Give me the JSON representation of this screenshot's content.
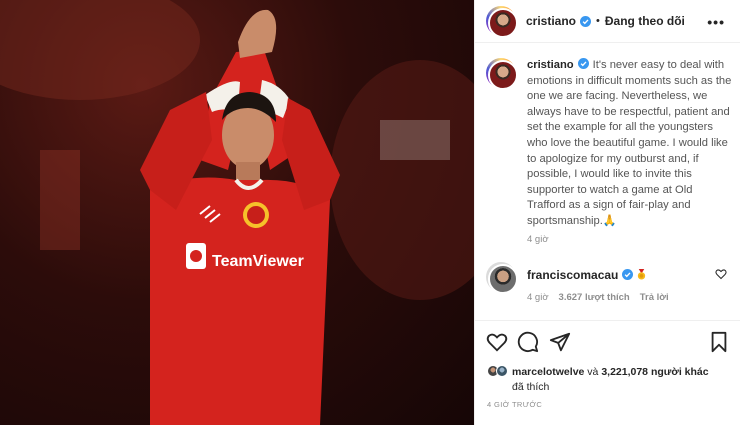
{
  "post": {
    "author": "cristiano",
    "follow_status": "Đang theo dõi",
    "more_glyph": "•••",
    "separator": "•"
  },
  "caption": {
    "username": "cristiano",
    "text": "It's never easy to deal with emotions in difficult moments such as the one we are facing. Nevertheless, we always have to be respectful, patient and set the example for all the youngsters who love the beautiful game. I would like to apologize for my outburst and, if possible, I would like to invite this supporter to watch a game at Old Trafford as a sign of fair-play and sportsmanship.🙏",
    "time": "4 giờ"
  },
  "comment": {
    "username": "franciscomacau",
    "time": "4 giờ",
    "likes": "3.627 lượt thích",
    "reply": "Trả lời"
  },
  "likes": {
    "liker": "marcelotwelve",
    "connector": "và",
    "others": "3,221,078 người khác",
    "liked": "đã thích"
  },
  "posted_time": "4 GIỜ TRƯỚC",
  "photo": {
    "jersey_sponsor": "TeamViewer"
  },
  "colors": {
    "verified": "#3897f0",
    "jersey_red": "#d4231e",
    "muted_text": "#8e8e8e"
  }
}
